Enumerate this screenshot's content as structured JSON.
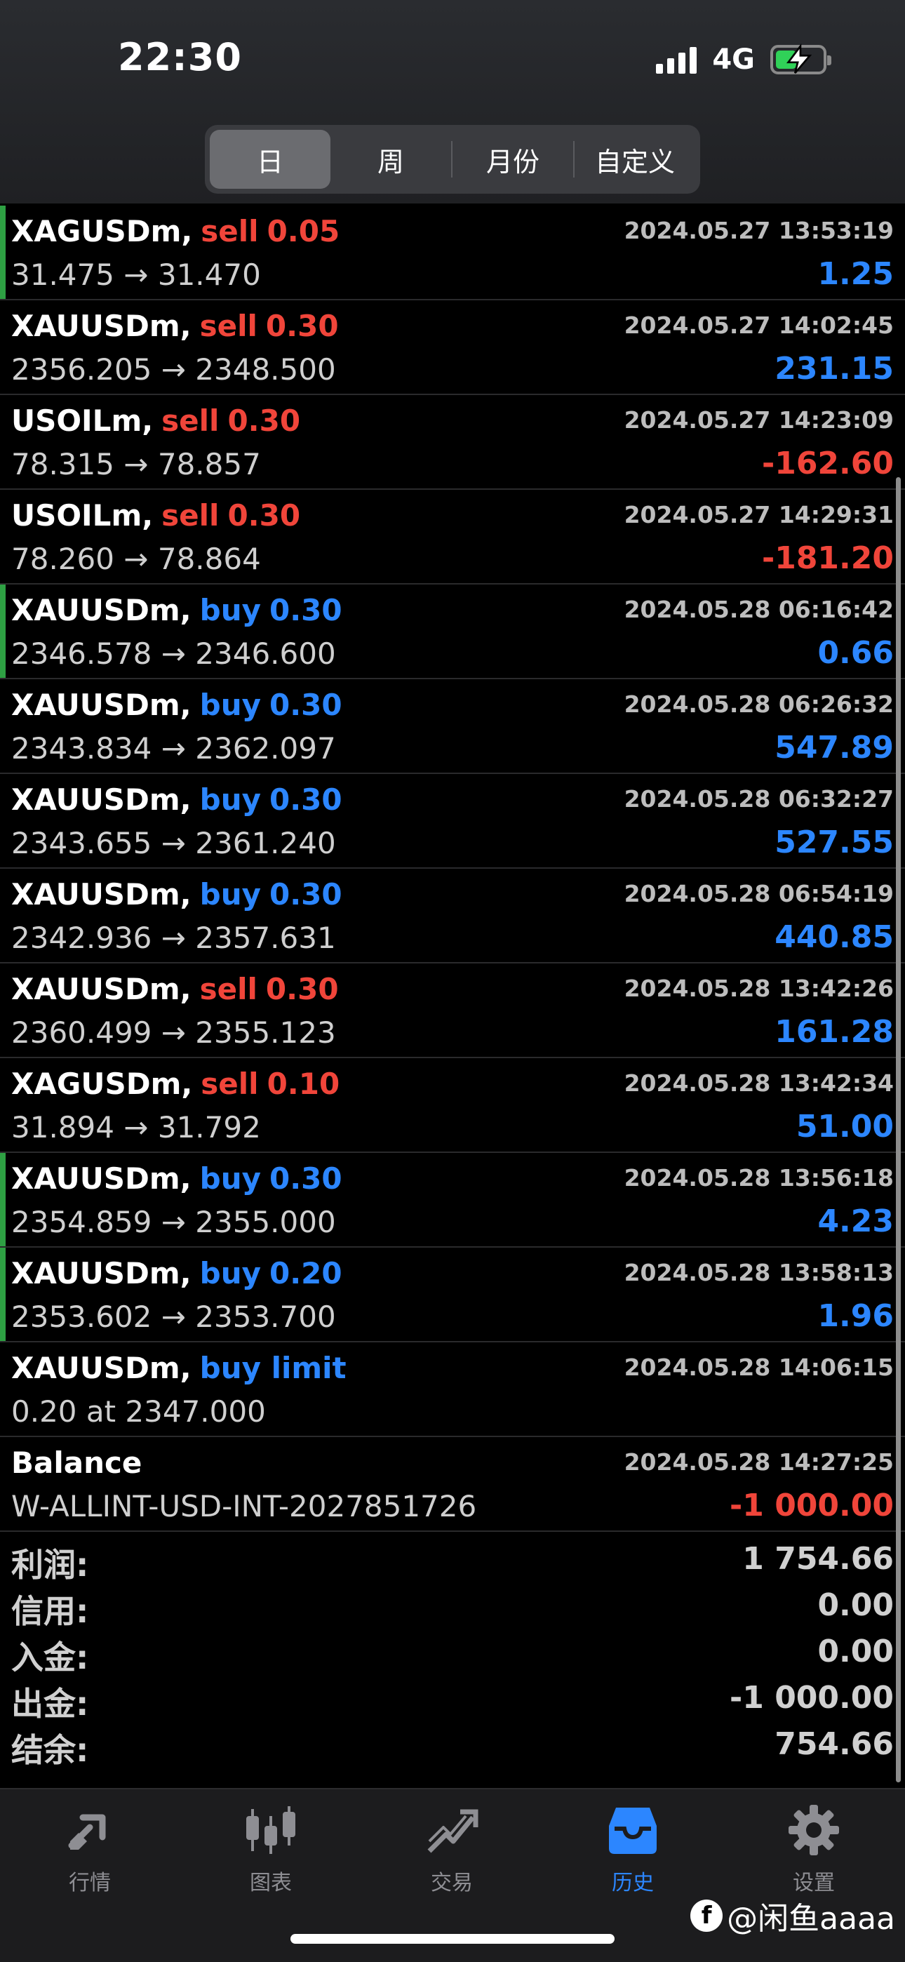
{
  "status_bar": {
    "time": "22:30",
    "network": "4G"
  },
  "period_tabs": [
    "日",
    "周",
    "月份",
    "自定义"
  ],
  "deals": [
    {
      "symbol": "XAGUSDm,",
      "side": "sell",
      "volume": "0.05",
      "prices": "31.475 → 31.470",
      "datetime": "2024.05.27 13:53:19",
      "profit": "1.25",
      "profit_sign": "pos",
      "bar": true
    },
    {
      "symbol": "XAUUSDm,",
      "side": "sell",
      "volume": "0.30",
      "prices": "2356.205 → 2348.500",
      "datetime": "2024.05.27 14:02:45",
      "profit": "231.15",
      "profit_sign": "pos",
      "bar": false
    },
    {
      "symbol": "USOILm,",
      "side": "sell",
      "volume": "0.30",
      "prices": "78.315 → 78.857",
      "datetime": "2024.05.27 14:23:09",
      "profit": "-162.60",
      "profit_sign": "neg",
      "bar": false
    },
    {
      "symbol": "USOILm,",
      "side": "sell",
      "volume": "0.30",
      "prices": "78.260 → 78.864",
      "datetime": "2024.05.27 14:29:31",
      "profit": "-181.20",
      "profit_sign": "neg",
      "bar": false
    },
    {
      "symbol": "XAUUSDm,",
      "side": "buy",
      "volume": "0.30",
      "prices": "2346.578 → 2346.600",
      "datetime": "2024.05.28 06:16:42",
      "profit": "0.66",
      "profit_sign": "pos",
      "bar": true
    },
    {
      "symbol": "XAUUSDm,",
      "side": "buy",
      "volume": "0.30",
      "prices": "2343.834 → 2362.097",
      "datetime": "2024.05.28 06:26:32",
      "profit": "547.89",
      "profit_sign": "pos",
      "bar": false
    },
    {
      "symbol": "XAUUSDm,",
      "side": "buy",
      "volume": "0.30",
      "prices": "2343.655 → 2361.240",
      "datetime": "2024.05.28 06:32:27",
      "profit": "527.55",
      "profit_sign": "pos",
      "bar": false
    },
    {
      "symbol": "XAUUSDm,",
      "side": "buy",
      "volume": "0.30",
      "prices": "2342.936 → 2357.631",
      "datetime": "2024.05.28 06:54:19",
      "profit": "440.85",
      "profit_sign": "pos",
      "bar": false
    },
    {
      "symbol": "XAUUSDm,",
      "side": "sell",
      "volume": "0.30",
      "prices": "2360.499 → 2355.123",
      "datetime": "2024.05.28 13:42:26",
      "profit": "161.28",
      "profit_sign": "pos",
      "bar": false
    },
    {
      "symbol": "XAGUSDm,",
      "side": "sell",
      "volume": "0.10",
      "prices": "31.894 → 31.792",
      "datetime": "2024.05.28 13:42:34",
      "profit": "51.00",
      "profit_sign": "pos",
      "bar": false
    },
    {
      "symbol": "XAUUSDm,",
      "side": "buy",
      "volume": "0.30",
      "prices": "2354.859 → 2355.000",
      "datetime": "2024.05.28 13:56:18",
      "profit": "4.23",
      "profit_sign": "pos",
      "bar": true
    },
    {
      "symbol": "XAUUSDm,",
      "side": "buy",
      "volume": "0.20",
      "prices": "2353.602 → 2353.700",
      "datetime": "2024.05.28 13:58:13",
      "profit": "1.96",
      "profit_sign": "pos",
      "bar": true
    },
    {
      "symbol": "XAUUSDm,",
      "side": "buy limit",
      "volume": "",
      "prices": "0.20 at 2347.000",
      "datetime": "2024.05.28 14:06:15",
      "profit": "",
      "profit_sign": "pos",
      "bar": false
    },
    {
      "symbol": "Balance",
      "side": "",
      "volume": "",
      "prices": "W-ALLINT-USD-INT-2027851726",
      "datetime": "2024.05.28 14:27:25",
      "profit": "-1 000.00",
      "profit_sign": "neg",
      "bar": false
    }
  ],
  "summary": [
    {
      "label": "利润:",
      "value": "1 754.66"
    },
    {
      "label": "信用:",
      "value": "0.00"
    },
    {
      "label": "入金:",
      "value": "0.00"
    },
    {
      "label": "出金:",
      "value": "-1 000.00"
    },
    {
      "label": "结余:",
      "value": "754.66"
    }
  ],
  "tabbar": [
    {
      "label": "行情",
      "icon": "quotes-arrows-icon",
      "active": false
    },
    {
      "label": "图表",
      "icon": "candlestick-chart-icon",
      "active": false
    },
    {
      "label": "交易",
      "icon": "trade-chart-icon",
      "active": false
    },
    {
      "label": "历史",
      "icon": "history-inbox-icon",
      "active": true
    },
    {
      "label": "设置",
      "icon": "gear-icon",
      "active": false
    }
  ],
  "watermark": "@闲鱼aaaa",
  "colors": {
    "sell": "#f0453a",
    "buy": "#2c86ff",
    "active_tab": "#2c86ff",
    "bar": "#2ea043"
  }
}
